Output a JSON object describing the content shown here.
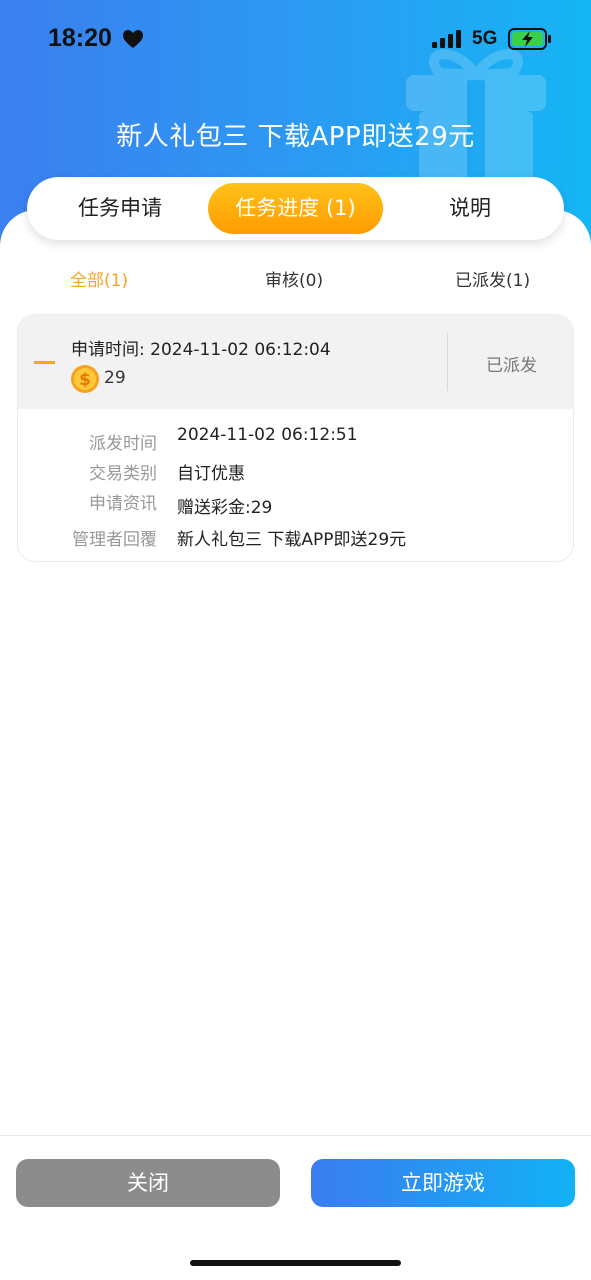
{
  "status_bar": {
    "time": "18:20",
    "network": "5G"
  },
  "header": {
    "title": "新人礼包三 下载APP即送29元"
  },
  "tabs": [
    {
      "label": "任务申请",
      "active": false
    },
    {
      "label": "任务进度 (1)",
      "active": true
    },
    {
      "label": "说明",
      "active": false
    }
  ],
  "filters": [
    {
      "label": "全部(1)",
      "active": true
    },
    {
      "label": "审核(0)",
      "active": false
    },
    {
      "label": "已派发(1)",
      "active": false
    }
  ],
  "record": {
    "apply_time": "申请时间: 2024-11-02 06:12:04",
    "amount": "29",
    "status": "已派发",
    "details": [
      {
        "label": "派发时间",
        "value": "2024-11-02 06:12:51"
      },
      {
        "label": "交易类别",
        "value": "自订优惠"
      },
      {
        "label": "申请资讯",
        "value": "赠送彩金:29"
      },
      {
        "label": "管理者回覆",
        "value": "新人礼包三 下载APP即送29元"
      }
    ]
  },
  "buttons": {
    "close": "关闭",
    "play": "立即游戏"
  },
  "colors": {
    "accent_orange": "#f5a623",
    "header_blue": "#2a9cf2",
    "close_gray": "#8c8c8c"
  }
}
